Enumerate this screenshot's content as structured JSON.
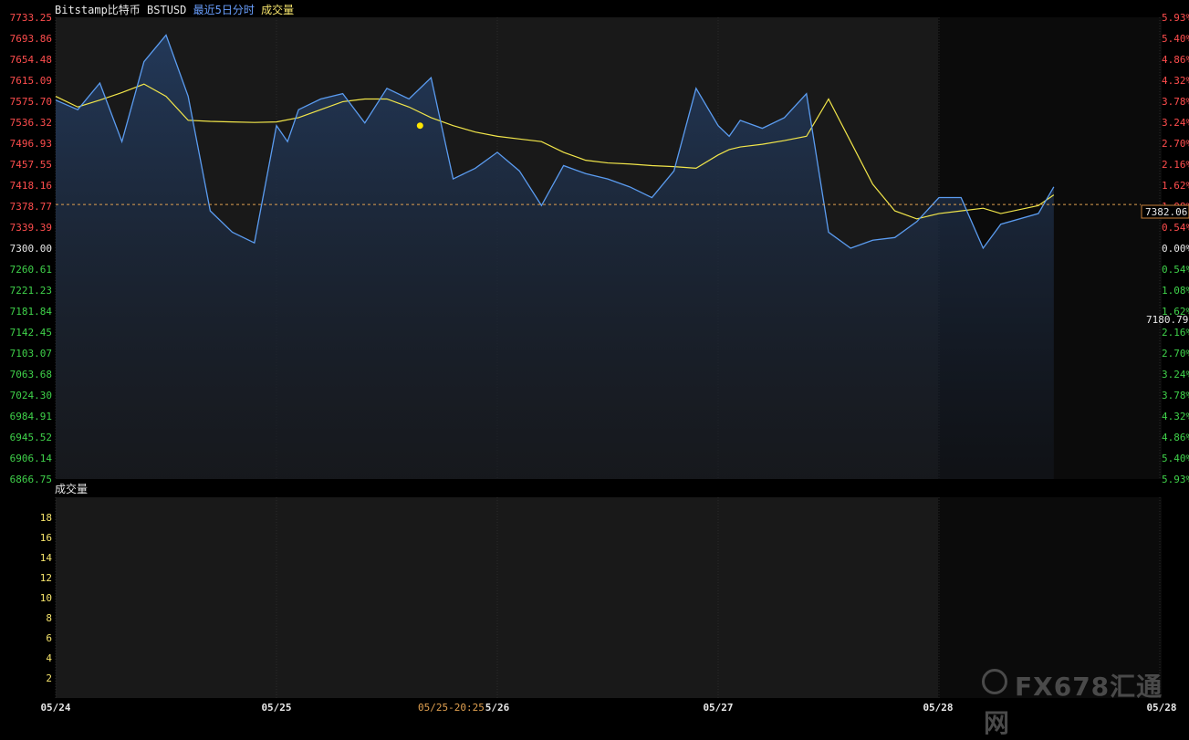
{
  "header": {
    "exchange": "Bitstamp比特币 BSTUSD",
    "period": "最近5日分时",
    "indicator": "成交量"
  },
  "volume_panel": {
    "title": "成交量"
  },
  "watermark": {
    "text": "FX678汇通网",
    "icon": "fx678-logo-icon"
  },
  "colors": {
    "price_line": "#5b9cf0",
    "avg_line": "#f2e64a",
    "up_label": "#ff4d4d",
    "down_label": "#3fd14a",
    "volume_label": "#f5e36b",
    "grid": "#2a2a2a"
  },
  "chart_data": {
    "type": "line",
    "title": "Bitstamp比特币 BSTUSD",
    "ylim": [
      6866.75,
      7733.25
    ],
    "reference_price": 7300.0,
    "current_price": "7382.06",
    "secondary_price": "7180.79",
    "cursor_time": "05/25-20:25",
    "y_ticks": [
      "7733.25",
      "7693.86",
      "7654.48",
      "7615.09",
      "7575.70",
      "7536.32",
      "7496.93",
      "7457.55",
      "7418.16",
      "7378.77",
      "7339.39",
      "7300.00",
      "7260.61",
      "7221.23",
      "7181.84",
      "7142.45",
      "7103.07",
      "7063.68",
      "7024.30",
      "6984.91",
      "6945.52",
      "6906.14",
      "6866.75"
    ],
    "pct_ticks": [
      "5.93%",
      "5.40%",
      "4.86%",
      "4.32%",
      "3.78%",
      "3.24%",
      "2.70%",
      "2.16%",
      "1.62%",
      "1.08%",
      "0.54%",
      "0.00%",
      "0.54%",
      "1.08%",
      "1.62%",
      "2.16%",
      "2.70%",
      "3.24%",
      "3.78%",
      "4.32%",
      "4.86%",
      "5.40%",
      "5.93%"
    ],
    "x_labels": [
      "05/24",
      "05/25",
      "5/26",
      "05/27",
      "05/28",
      "05/28"
    ],
    "volume_ticks": [
      "18",
      "16",
      "14",
      "12",
      "10",
      "8",
      "6",
      "4",
      "2"
    ],
    "series": [
      {
        "role": "price",
        "x": [
          0,
          0.1,
          0.2,
          0.3,
          0.4,
          0.5,
          0.6,
          0.7,
          0.8,
          0.9,
          1.0,
          1.05,
          1.1,
          1.2,
          1.3,
          1.4,
          1.5,
          1.6,
          1.7,
          1.8,
          1.9,
          2.0,
          2.1,
          2.2,
          2.3,
          2.4,
          2.5,
          2.6,
          2.7,
          2.8,
          2.9,
          3.0,
          3.05,
          3.1,
          3.2,
          3.3,
          3.4,
          3.5,
          3.6,
          3.7,
          3.8,
          3.9,
          4.0,
          4.1,
          4.2,
          4.28,
          4.45,
          4.52
        ],
        "y": [
          7578,
          7560,
          7610,
          7500,
          7650,
          7700,
          7585,
          7370,
          7330,
          7310,
          7530,
          7500,
          7560,
          7580,
          7590,
          7535,
          7600,
          7580,
          7620,
          7430,
          7450,
          7480,
          7445,
          7380,
          7455,
          7440,
          7430,
          7415,
          7395,
          7445,
          7600,
          7530,
          7510,
          7540,
          7525,
          7545,
          7590,
          7330,
          7300,
          7315,
          7320,
          7350,
          7395,
          7395,
          7300,
          7345,
          7365,
          7415
        ]
      },
      {
        "role": "average",
        "x": [
          0,
          0.1,
          0.2,
          0.3,
          0.4,
          0.5,
          0.6,
          0.7,
          0.8,
          0.9,
          1.0,
          1.1,
          1.2,
          1.3,
          1.4,
          1.5,
          1.6,
          1.7,
          1.8,
          1.9,
          2.0,
          2.1,
          2.2,
          2.3,
          2.4,
          2.5,
          2.6,
          2.7,
          2.8,
          2.9,
          3.0,
          3.05,
          3.1,
          3.2,
          3.3,
          3.4,
          3.5,
          3.6,
          3.7,
          3.8,
          3.9,
          4.0,
          4.1,
          4.2,
          4.28,
          4.45,
          4.52
        ],
        "y": [
          7585,
          7565,
          7578,
          7592,
          7608,
          7585,
          7540,
          7538,
          7537,
          7536,
          7537,
          7545,
          7560,
          7575,
          7580,
          7580,
          7565,
          7545,
          7530,
          7518,
          7510,
          7505,
          7500,
          7480,
          7465,
          7460,
          7458,
          7455,
          7453,
          7450,
          7475,
          7485,
          7490,
          7495,
          7502,
          7510,
          7580,
          7500,
          7420,
          7370,
          7355,
          7365,
          7370,
          7375,
          7365,
          7380,
          7400
        ]
      }
    ]
  }
}
